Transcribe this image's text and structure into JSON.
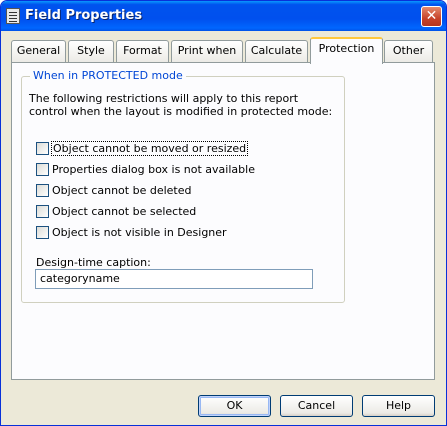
{
  "window": {
    "title": "Field Properties",
    "close_glyph": "✕",
    "icon": "form-icon"
  },
  "tabs": [
    {
      "label": "General"
    },
    {
      "label": "Style"
    },
    {
      "label": "Format"
    },
    {
      "label": "Print when"
    },
    {
      "label": "Calculate"
    },
    {
      "label": "Protection",
      "selected": true
    },
    {
      "label": "Other"
    }
  ],
  "group": {
    "title": "When in PROTECTED mode",
    "description": "The following restrictions will apply to this report control when the layout is modified in protected mode:"
  },
  "checkboxes": [
    {
      "label": "Object cannot be moved or resized",
      "checked": false
    },
    {
      "label": "Properties dialog box is not available",
      "checked": false
    },
    {
      "label": "Object cannot be deleted",
      "checked": false
    },
    {
      "label": "Object cannot be selected",
      "checked": false
    },
    {
      "label": "Object is not visible in Designer",
      "checked": false
    }
  ],
  "caption": {
    "label": "Design-time caption:",
    "value": "categoryname"
  },
  "buttons": {
    "ok": "OK",
    "cancel": "Cancel",
    "help": "Help"
  },
  "colors": {
    "title_bar": "#0054e3",
    "dialog_bg": "#ece9d8",
    "group_title": "#0046d5",
    "active_tab_accent": "#ffc83c"
  }
}
